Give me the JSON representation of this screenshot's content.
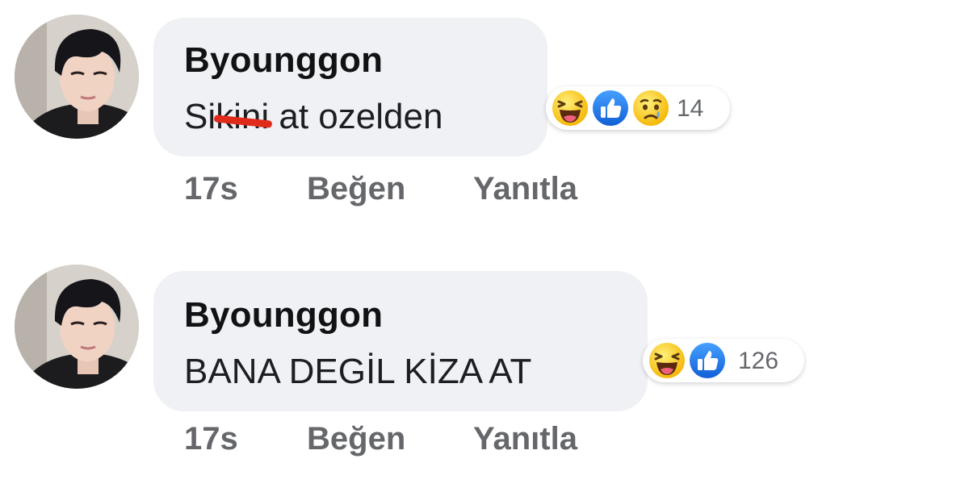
{
  "comments": [
    {
      "author": "Byounggon",
      "text_prefix": "Si",
      "text_censored": "kini",
      "text_suffix": " at ozelden",
      "reaction_icons": [
        "laugh-emoji",
        "like-thumb",
        "sad-emoji"
      ],
      "reaction_count": "14",
      "time": "17s",
      "like_label": "Beğen",
      "reply_label": "Yanıtla"
    },
    {
      "author": "Byounggon",
      "text": "BANA DEGİL KİZA AT",
      "reaction_icons": [
        "laugh-emoji",
        "like-thumb"
      ],
      "reaction_count": "126",
      "time": "17s",
      "like_label": "Beğen",
      "reply_label": "Yanıtla"
    }
  ],
  "colors": {
    "bubble_bg": "#eff1f4",
    "meta_text": "#65676b",
    "like_blue": "#1877f2",
    "censor_red": "#e02a1a"
  }
}
